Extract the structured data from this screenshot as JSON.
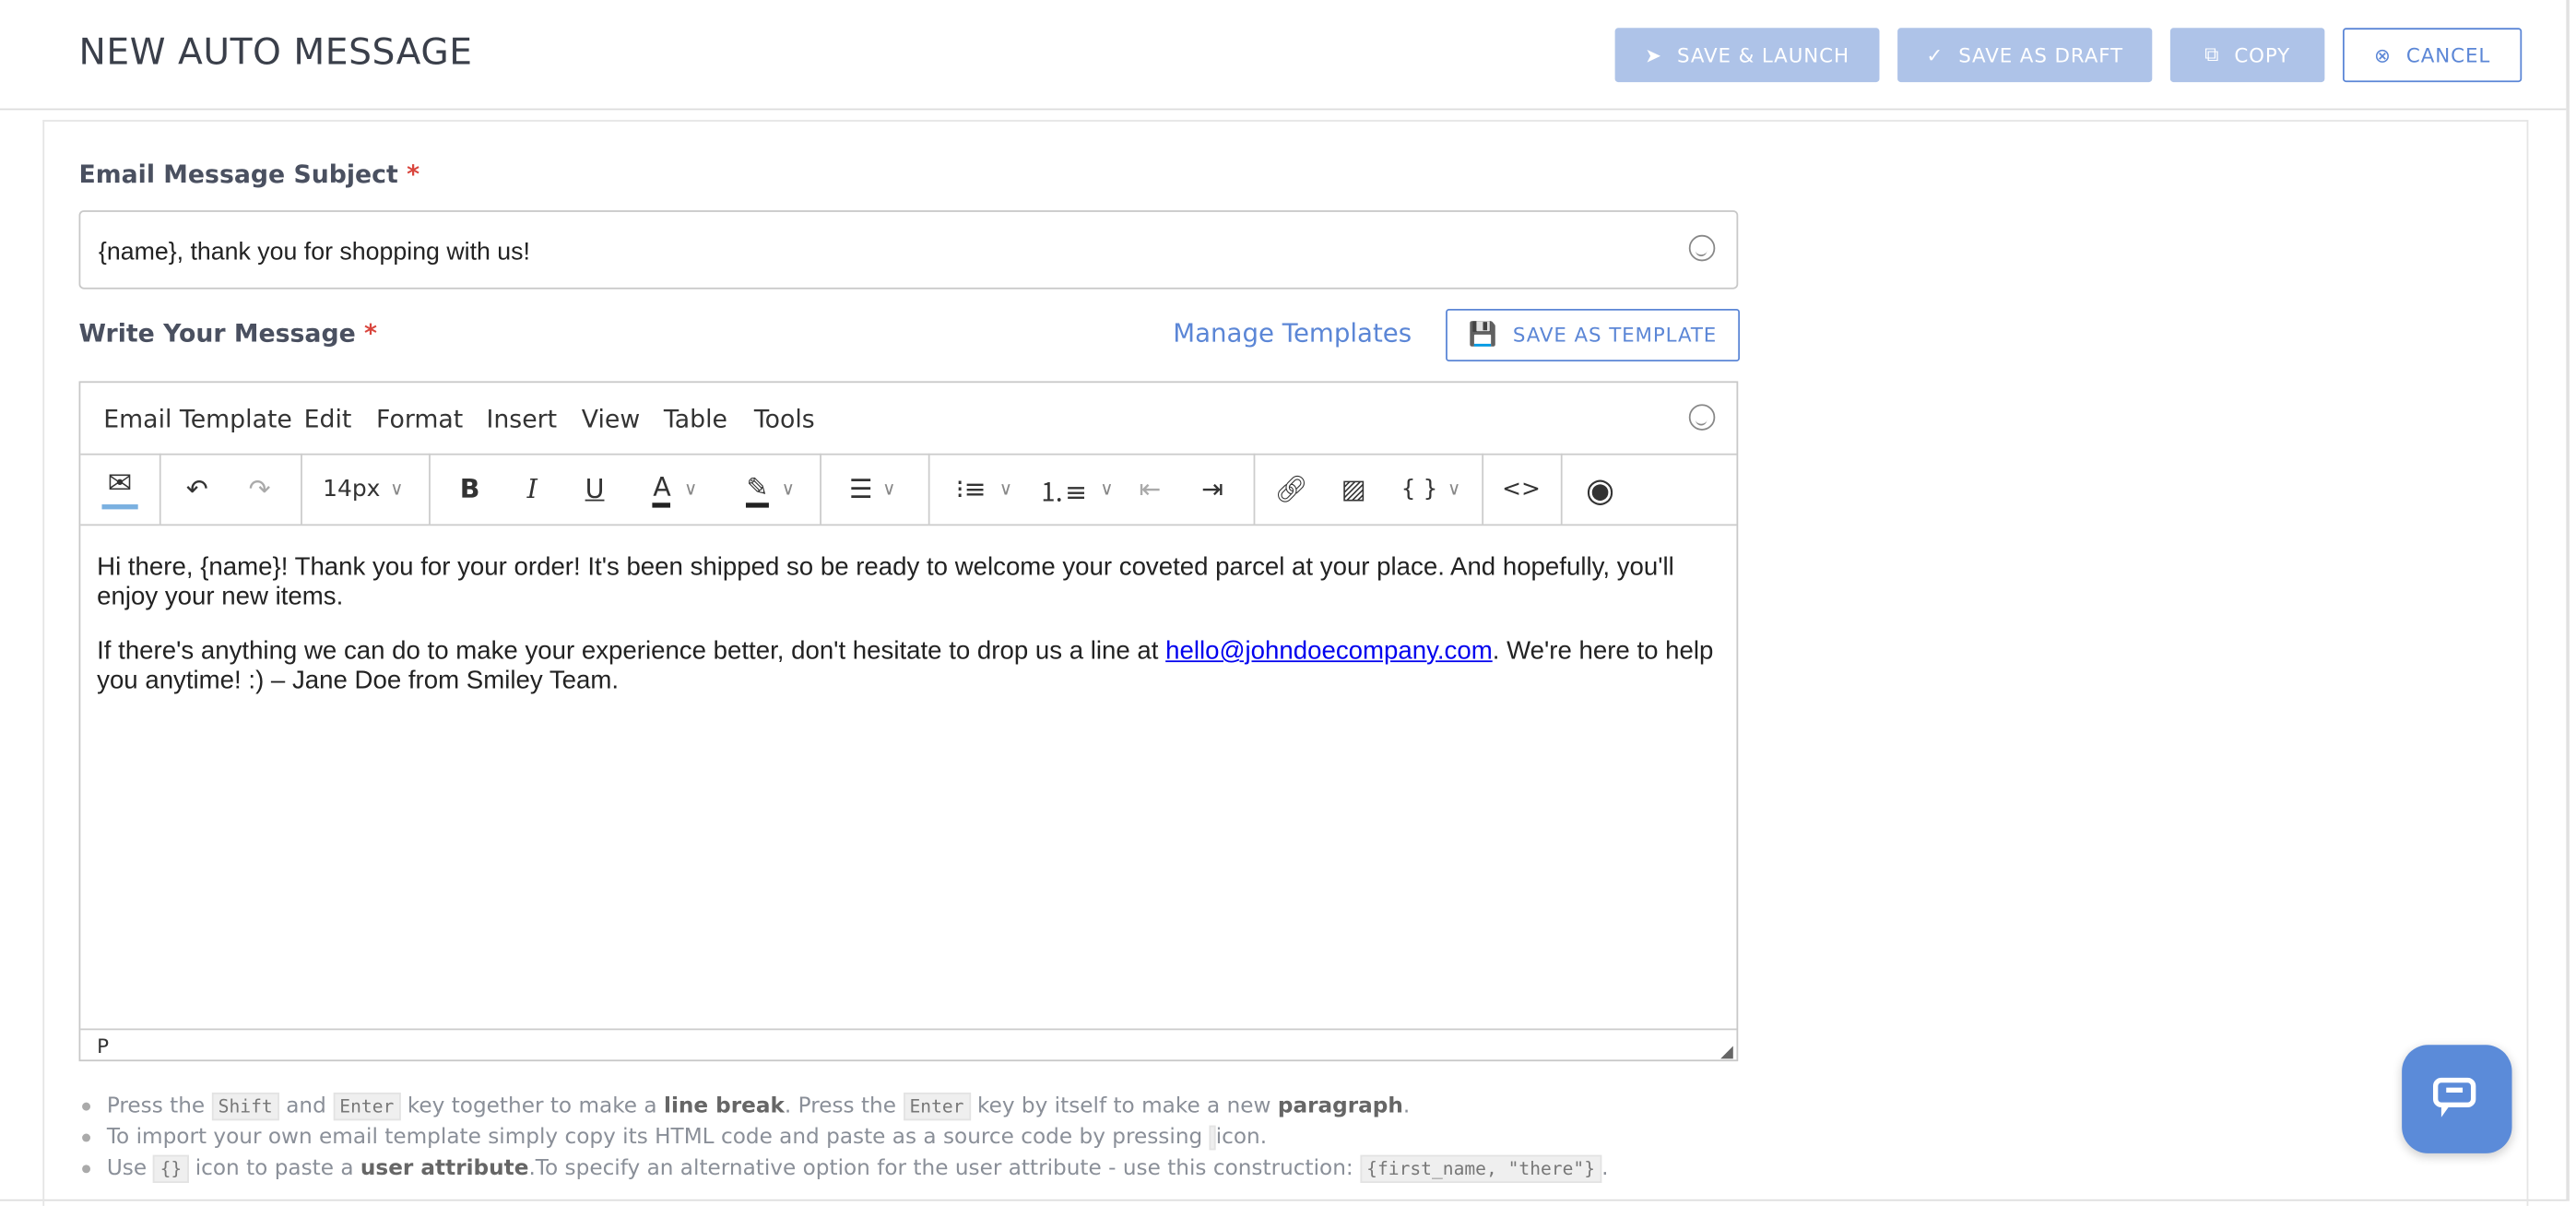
{
  "header": {
    "title": "NEW AUTO MESSAGE",
    "buttons": {
      "save_launch": "SAVE & LAUNCH",
      "save_draft": "SAVE AS DRAFT",
      "copy": "COPY",
      "cancel": "CANCEL"
    }
  },
  "subject": {
    "label": "Email Message Subject",
    "required": "*",
    "value": "{name}, thank you for shopping with us!"
  },
  "message": {
    "label": "Write Your Message",
    "required": "*",
    "manage_templates": "Manage Templates",
    "save_template": "SAVE AS TEMPLATE"
  },
  "editor": {
    "menu": [
      "Email Template",
      "Edit",
      "Format",
      "Insert",
      "View",
      "Table",
      "Tools"
    ],
    "font_size": "14px",
    "paragraph1": "Hi there, {name}! Thank you for your order! It's been shipped so be ready to welcome your coveted parcel at your place. And hopefully, you'll enjoy your new items.",
    "paragraph2_before": "If there's anything we can do to make your experience better, don't hesitate to drop us a line at ",
    "email_link": "hello@johndoecompany.com",
    "paragraph2_after": ". We're here to help you anytime! :) – Jane Doe from Smiley Team.",
    "status_path": "P"
  },
  "notes": {
    "n1": {
      "a": "Press the ",
      "k1": "Shift",
      "b": " and ",
      "k2": "Enter",
      "c": " key together to make a ",
      "b1": "line break",
      "d": ". Press the ",
      "k3": "Enter",
      "e": " key by itself to make a new ",
      "b2": "paragraph",
      "f": "."
    },
    "n2": {
      "a": "To import your own email template simply copy its HTML code and paste as a source code by pressing ",
      "b": " icon."
    },
    "n3": {
      "a": "Use ",
      "k1": "{}",
      "b": " icon to paste a ",
      "b1": "user attribute",
      "c": ".To specify an alternative option for the user attribute - use this construction: ",
      "k2": "{first_name, \"there\"}",
      "d": "."
    }
  },
  "colors": {
    "accent": "#5b86d6",
    "disabled": "#aec3e8",
    "required": "#d9453d",
    "chat": "#5b8bd9"
  }
}
